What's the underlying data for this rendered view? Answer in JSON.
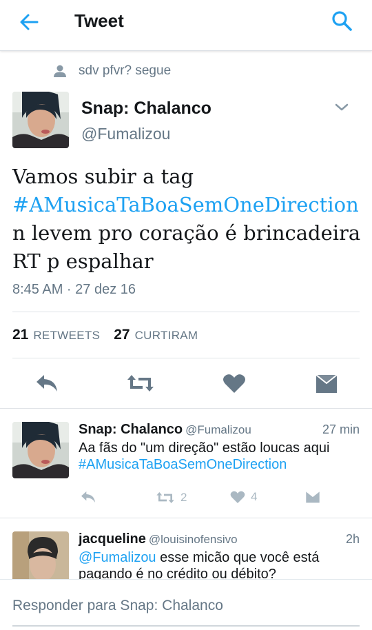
{
  "topbar": {
    "title": "Tweet",
    "back_icon": "arrow-left-icon",
    "search_icon": "search-icon",
    "accent": "#1da1f2"
  },
  "social_context": {
    "icon": "person-icon",
    "text": "sdv pfvr? segue"
  },
  "tweet": {
    "author_name": "Snap: Chalanco",
    "author_handle": "@Fumalizou",
    "text_line1": "Vamos subir a tag",
    "hashtag": "#AMusicaTaBoaSemOneDirection",
    "text_line3": "n levem pro coração é brincadeira",
    "text_line4": "RT p espalhar",
    "timestamp": "8:45 AM · 27 dez 16"
  },
  "stats": {
    "retweets_count": "21",
    "retweets_label": "RETWEETS",
    "likes_count": "27",
    "likes_label": "CURTIRAM"
  },
  "actions": [
    "reply-icon",
    "retweet-icon",
    "heart-icon",
    "message-icon"
  ],
  "replies": [
    {
      "name": "Snap: Chalanco",
      "handle": "@Fumalizou",
      "time": "27 min",
      "text": "Aa fãs do \"um direção\" estão loucas aqui",
      "hashtag": "#AMusicaTaBoaSemOneDirection",
      "retweets": "2",
      "likes": "4"
    },
    {
      "name": "jacqueline",
      "handle": "@louisinofensivo",
      "time": "2h",
      "mention": "@Fumalizou",
      "text": " esse micão que você está",
      "text_line2": "pagando é no crédito ou débito?"
    }
  ],
  "compose": {
    "placeholder": "Responder para Snap: Chalanco"
  },
  "colors": {
    "link": "#1da1f2",
    "secondary_text": "#657786",
    "icon_grey": "#657786"
  }
}
